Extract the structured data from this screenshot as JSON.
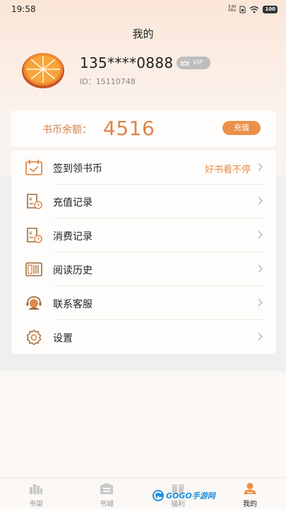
{
  "status_bar": {
    "time": "19:58",
    "net_speed_value": "8.80",
    "net_speed_unit": "KB/s",
    "battery": "100"
  },
  "page": {
    "title": "我的"
  },
  "profile": {
    "phone": "135****0888",
    "vip_label": "VIP",
    "user_id": "ID：15110748"
  },
  "balance": {
    "label": "书币余额：",
    "value": "4516",
    "recharge_label": "充值"
  },
  "menu": {
    "items": [
      {
        "label": "签到领书币",
        "extra": "好书看不停",
        "icon": "calendar-checkin-icon"
      },
      {
        "label": "充值记录",
        "icon": "recharge-record-icon"
      },
      {
        "label": "消费记录",
        "icon": "consume-record-icon"
      },
      {
        "label": "阅读历史",
        "icon": "reading-history-icon"
      },
      {
        "label": "联系客服",
        "icon": "customer-service-icon"
      },
      {
        "label": "设置",
        "icon": "settings-gear-icon"
      }
    ]
  },
  "tabbar": {
    "tabs": [
      {
        "label": "书架",
        "icon": "bookshelf-icon"
      },
      {
        "label": "书城",
        "icon": "bookstore-icon"
      },
      {
        "label": "福利",
        "icon": "welfare-icon"
      },
      {
        "label": "我的",
        "icon": "profile-icon",
        "active": true
      }
    ]
  },
  "watermark": {
    "text": "GOGO手游网"
  },
  "colors": {
    "accent": "#ec9049",
    "balance_text": "#e0844a",
    "page_bg_top": "#fbe6d8"
  }
}
